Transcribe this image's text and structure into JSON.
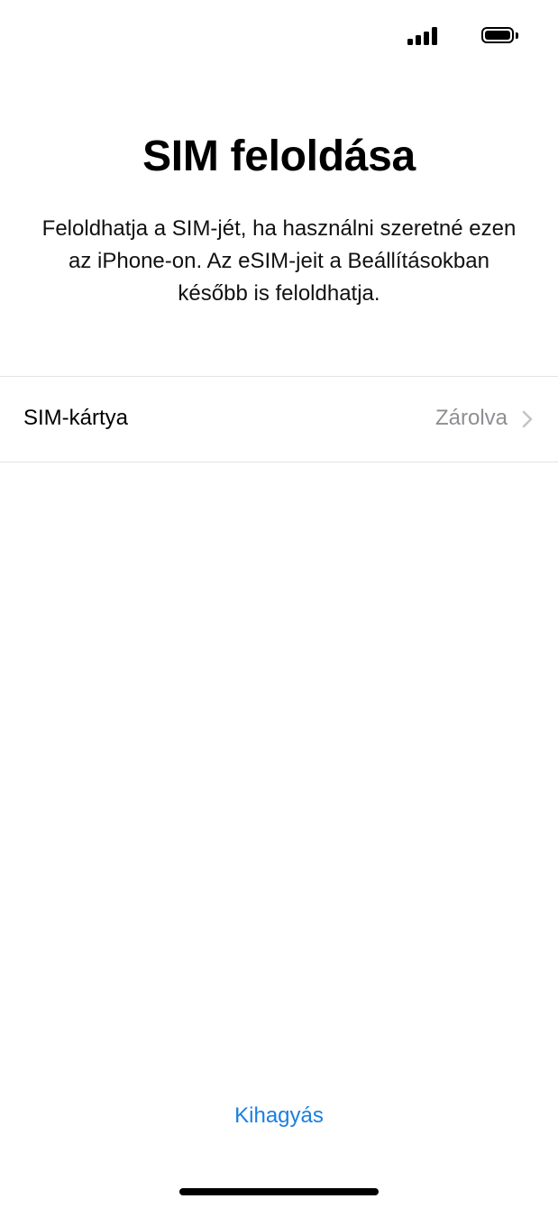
{
  "status_bar": {
    "signal_icon": "cellular-signal-icon",
    "battery_icon": "battery-full-icon"
  },
  "header": {
    "title": "SIM feloldása",
    "description": "Feloldhatja a SIM-jét, ha használni szeretné ezen az iPhone-on. Az eSIM-jeit a Beállításokban később is feloldhatja."
  },
  "sim_row": {
    "label": "SIM-kártya",
    "value": "Zárolva",
    "chevron_icon": "chevron-right-icon"
  },
  "footer": {
    "skip_label": "Kihagyás"
  },
  "colors": {
    "accent": "#1a7fe0",
    "secondary_text": "#8e8e93",
    "divider": "#e3e3e6"
  }
}
